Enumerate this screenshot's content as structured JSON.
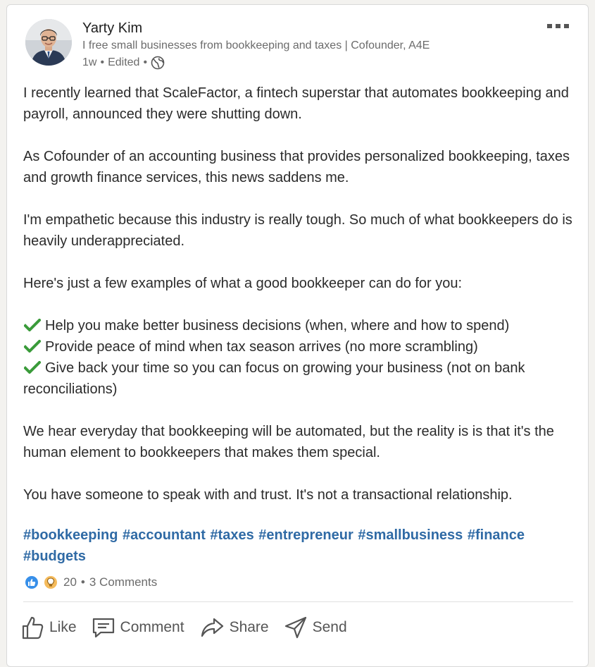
{
  "author": {
    "name": "Yarty Kim",
    "headline": "I free small businesses from bookkeeping and taxes | Cofounder, A4E",
    "time": "1w",
    "edited": "Edited",
    "sep1": "•",
    "sep2": "•"
  },
  "post": {
    "paragraphs": [
      "I recently learned that ScaleFactor, a fintech superstar that automates bookkeeping and payroll, announced they were shutting down.",
      "As Cofounder of an accounting business that provides personalized bookkeeping, taxes and growth finance services, this news saddens me.",
      "I'm empathetic because this industry is really tough. So much of what bookkeepers do is heavily underappreciated.",
      "Here's just a few examples of what a good bookkeeper can do for you:"
    ],
    "checklist": [
      "Help you make better business decisions (when, where and how to spend)",
      "Provide peace of mind when tax season arrives (no more scrambling)",
      "Give back your time so you can focus on growing your business (not on bank reconciliations)"
    ],
    "closing": [
      "We hear everyday that bookkeeping will be automated, but the reality is is that it's the human element to bookkeepers that makes them special.",
      "You have someone to speak with and trust. It's not a transactional relationship."
    ],
    "hashtags": [
      "#bookkeeping",
      "#accountant",
      "#taxes",
      "#entrepreneur",
      "#smallbusiness",
      "#finance",
      "#budgets"
    ]
  },
  "social": {
    "reaction_count": "20",
    "sep": "•",
    "comments": "3 Comments"
  },
  "actions": {
    "like": "Like",
    "comment": "Comment",
    "share": "Share",
    "send": "Send"
  },
  "colors": {
    "hashtag": "#2f6aa5",
    "check": "#3a9b3a",
    "like_reaction": "#378fe9",
    "insight_reaction": "#f5bb5c"
  },
  "icons": {
    "more": "more-horizontal-icon",
    "visibility": "globe-icon",
    "check": "check-mark-icon",
    "like": "thumbs-up-icon",
    "comment": "comment-icon",
    "share": "share-arrow-icon",
    "send": "paper-plane-icon"
  }
}
